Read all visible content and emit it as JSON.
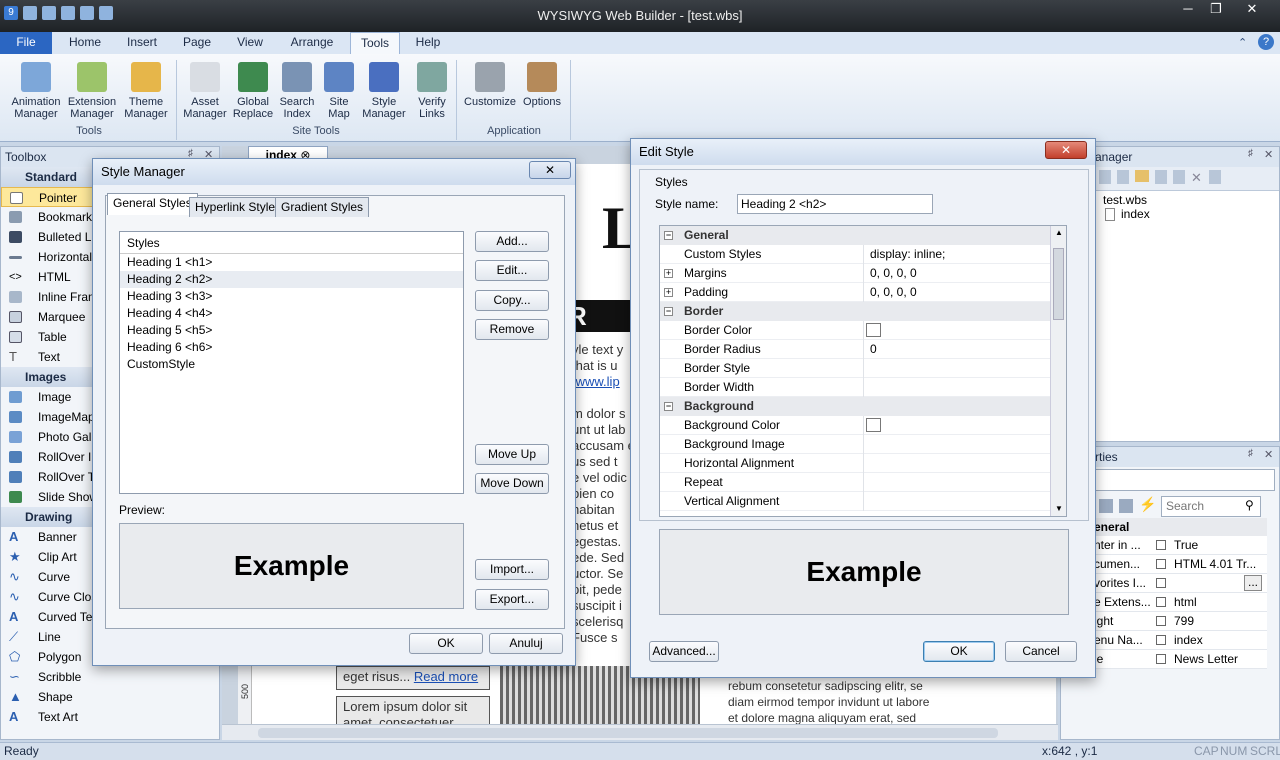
{
  "app": {
    "title": "WYSIWYG Web Builder - [test.wbs]"
  },
  "menu_tabs": [
    "File",
    "Home",
    "Insert",
    "Page",
    "View",
    "Arrange",
    "Tools",
    "Help"
  ],
  "ribbon": {
    "buttons": [
      {
        "l1": "Animation",
        "l2": "Manager"
      },
      {
        "l1": "Extension",
        "l2": "Manager"
      },
      {
        "l1": "Theme",
        "l2": "Manager"
      },
      {
        "l1": "Asset",
        "l2": "Manager"
      },
      {
        "l1": "Global",
        "l2": "Replace"
      },
      {
        "l1": "Search",
        "l2": "Index"
      },
      {
        "l1": "Site",
        "l2": "Map"
      },
      {
        "l1": "Style",
        "l2": "Manager"
      },
      {
        "l1": "Verify",
        "l2": "Links"
      },
      {
        "l1": "Customize",
        "l2": ""
      },
      {
        "l1": "Options",
        "l2": ""
      }
    ],
    "groups": [
      "Tools",
      "Site Tools",
      "Application"
    ]
  },
  "toolbox": {
    "title": "Toolbox",
    "sections": [
      {
        "name": "Standard",
        "items": [
          "Pointer",
          "Bookmark",
          "Bulleted Li",
          "Horizontal",
          "HTML",
          "Inline Fram",
          "Marquee",
          "Table",
          "Text"
        ]
      },
      {
        "name": "Images",
        "items": [
          "Image",
          "ImageMap",
          "Photo Gall",
          "RollOver In",
          "RollOver Te",
          "Slide Show"
        ]
      },
      {
        "name": "Drawing",
        "items": [
          "Banner",
          "Clip Art",
          "Curve",
          "Curve Clos",
          "Curved Tex",
          "Line",
          "Polygon",
          "Scribble",
          "Shape",
          "Text Art"
        ]
      }
    ]
  },
  "doc": {
    "tab": "index",
    "letter": "L",
    "heading": "R HEA",
    "lines": [
      "yle text y",
      "that is u",
      "/www.lip"
    ],
    "body": [
      "m dolor s",
      "unt ut lab",
      "accusam e",
      "us sed t",
      "e vel odic",
      "bien co",
      "habitan",
      "netus et",
      "egestas.",
      "ede. Sed",
      "uctor. Se",
      "pit, pede",
      "suscipit i",
      "scelerisq",
      "Fusce s"
    ],
    "left_box": "eget risus...",
    "left_link": "Read more",
    "left_box2": "Lorem ipsum dolor sit amet, consectetuer",
    "right_text": [
      "rebum consetetur sadipscing elitr, se",
      "diam eirmod tempor invidunt ut labore",
      "et dolore magna aliquyam erat, sed"
    ],
    "ruler": "500"
  },
  "site_manager": {
    "title": "anager",
    "root": "test.wbs",
    "page": "index"
  },
  "properties": {
    "title": "rties",
    "search_placeholder": "Search",
    "section": "eneral",
    "rows": [
      {
        "k": "nter in ...",
        "v": "True"
      },
      {
        "k": "cumen...",
        "v": "HTML 4.01 Tr..."
      },
      {
        "k": "vorites I...",
        "v": ""
      },
      {
        "k": "e Extens...",
        "v": "html"
      },
      {
        "k": "ight",
        "v": "799"
      },
      {
        "k": "enu Na...",
        "v": "index"
      },
      {
        "k": "le",
        "v": "News Letter"
      }
    ]
  },
  "style_manager": {
    "title": "Style Manager",
    "tabs": [
      "General Styles",
      "Hyperlink Styles",
      "Gradient Styles"
    ],
    "list_header": "Styles",
    "items": [
      "Heading 1 <h1>",
      "Heading 2 <h2>",
      "Heading 3 <h3>",
      "Heading 4 <h4>",
      "Heading 5 <h5>",
      "Heading 6 <h6>",
      "CustomStyle"
    ],
    "selected": 1,
    "buttons": {
      "add": "Add...",
      "edit": "Edit...",
      "copy": "Copy...",
      "remove": "Remove",
      "move_up": "Move Up",
      "move_down": "Move Down",
      "import": "Import...",
      "export": "Export...",
      "ok": "OK",
      "cancel": "Anuluj"
    },
    "preview_label": "Preview:",
    "preview_text": "Example"
  },
  "edit_style": {
    "title": "Edit Style",
    "group": "Styles",
    "name_label": "Style name:",
    "name_value": "Heading 2 <h2>",
    "rows": [
      {
        "type": "cat",
        "name": "General"
      },
      {
        "type": "prop",
        "name": "Custom Styles",
        "value": "display: inline;"
      },
      {
        "type": "exp",
        "name": "Margins",
        "value": "0, 0, 0, 0"
      },
      {
        "type": "exp",
        "name": "Padding",
        "value": "0, 0, 0, 0"
      },
      {
        "type": "cat",
        "name": "Border"
      },
      {
        "type": "color",
        "name": "Border Color",
        "value": ""
      },
      {
        "type": "prop",
        "name": "Border Radius",
        "value": "0"
      },
      {
        "type": "prop",
        "name": "Border Style",
        "value": ""
      },
      {
        "type": "prop",
        "name": "Border Width",
        "value": ""
      },
      {
        "type": "cat",
        "name": "Background"
      },
      {
        "type": "color",
        "name": "Background Color",
        "value": ""
      },
      {
        "type": "prop",
        "name": "Background Image",
        "value": ""
      },
      {
        "type": "prop",
        "name": "Horizontal Alignment",
        "value": ""
      },
      {
        "type": "prop",
        "name": "Repeat",
        "value": ""
      },
      {
        "type": "prop",
        "name": "Vertical Alignment",
        "value": ""
      }
    ],
    "preview_text": "Example",
    "buttons": {
      "advanced": "Advanced...",
      "ok": "OK",
      "cancel": "Cancel"
    }
  },
  "status": {
    "left": "Ready",
    "coords": "x:642 , y:1",
    "keys": [
      "CAP",
      "NUM",
      "SCRL"
    ]
  }
}
